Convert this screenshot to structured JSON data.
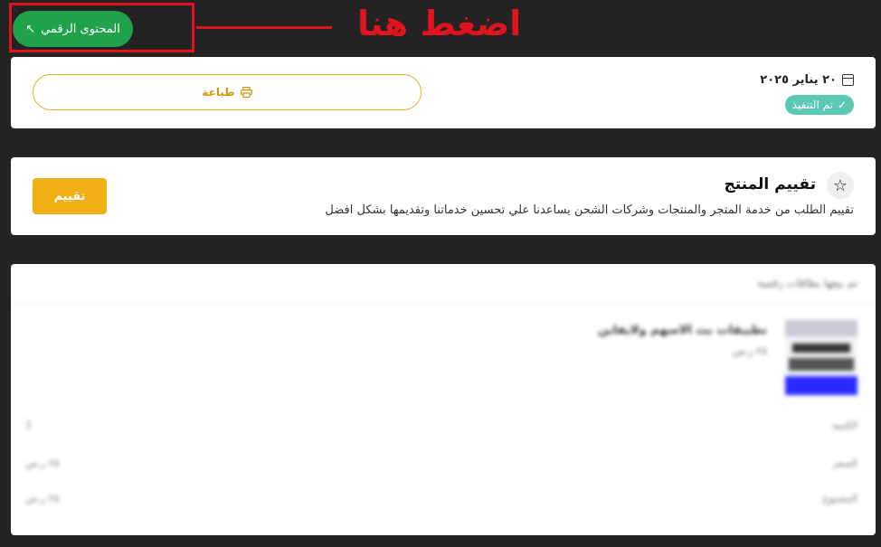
{
  "annotation": {
    "text": "اضغط هنا"
  },
  "digital_content": {
    "label": "المحتوى الرقمي",
    "icon": "arrow-up-left-icon"
  },
  "order": {
    "print_label": "طباعة",
    "date": "٢٠ يناير ٢٠٢٥",
    "status": "تم التنفيذ"
  },
  "rating": {
    "title": "تقييم المنتج",
    "description": "تقييم الطلب من خدمة المتجر والمنتجات وشركات الشحن يساعدنا علي تحسين خدماتنا وتقديمها بشكل افضل",
    "button_label": "تقييم"
  },
  "details": {
    "header": "تم بيعها بطاقات رقمية",
    "product": {
      "name": "تطبيقات بث الاسهم ولايفاين",
      "price": "٢٥ ر.س"
    },
    "summary": [
      {
        "label": "الكمية",
        "value": "1"
      },
      {
        "label": "السعر",
        "value": "٢٥ ر.س"
      },
      {
        "label": "المجموع",
        "value": "٢٥ ر.س"
      }
    ]
  },
  "colors": {
    "background": "#232323",
    "green": "#1fa24a",
    "accent": "#eeb016",
    "status": "#5cc9b6",
    "annotation": "#e0141e"
  }
}
